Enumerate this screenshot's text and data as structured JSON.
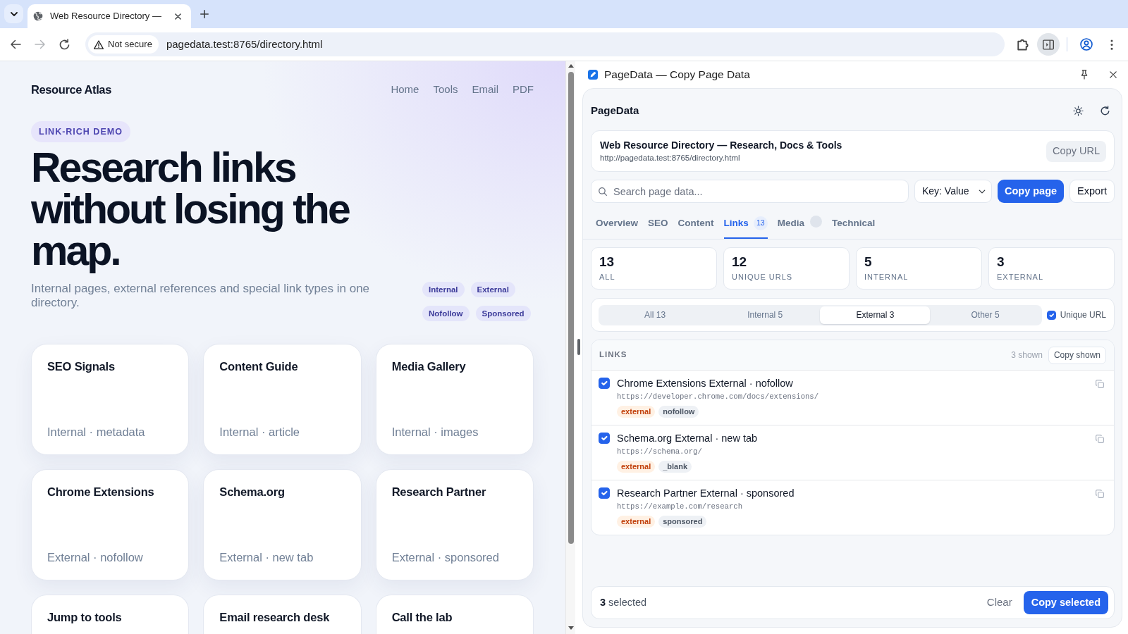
{
  "browser": {
    "tab": {
      "title": "Web Resource Directory —"
    },
    "security_label": "Not secure",
    "url": "pagedata.test:8765/directory.html",
    "forward_disabled": true,
    "side_panel_active": true
  },
  "site": {
    "brand": "Resource Atlas",
    "nav": [
      "Home",
      "Tools",
      "Email",
      "PDF"
    ],
    "eyebrow": "LINK-RICH DEMO",
    "headline": "Research links without losing the map.",
    "lede": "Internal pages, external references and special link types in one directory.",
    "tags": [
      "Internal",
      "External",
      "Nofollow",
      "Sponsored"
    ],
    "cards": [
      {
        "title": "SEO Signals",
        "meta": "Internal · metadata"
      },
      {
        "title": "Content Guide",
        "meta": "Internal · article"
      },
      {
        "title": "Media Gallery",
        "meta": "Internal · images"
      },
      {
        "title": "Chrome Extensions",
        "meta": "External · nofollow"
      },
      {
        "title": "Schema.org",
        "meta": "External · new tab"
      },
      {
        "title": "Research Partner",
        "meta": "External · sponsored"
      },
      {
        "title": "Jump to tools"
      },
      {
        "title": "Email research desk"
      },
      {
        "title": "Call the lab"
      }
    ]
  },
  "side_panel": {
    "title": "PageData — Copy Page Data",
    "app_name": "PageData",
    "page": {
      "title": "Web Resource Directory — Research, Docs & Tools",
      "url": "http://pagedata.test:8765/directory.html",
      "copy_button": "Copy URL"
    },
    "search": {
      "placeholder": "Search page data..."
    },
    "format": {
      "value": "Key: Value"
    },
    "copy_page_button": "Copy page",
    "export_button": "Export",
    "tabs": [
      {
        "label": "Overview",
        "selected": false
      },
      {
        "label": "SEO",
        "selected": false
      },
      {
        "label": "Content",
        "selected": false
      },
      {
        "label": "Links",
        "count": "13",
        "selected": true
      },
      {
        "label": "Media",
        "count_pending": true,
        "selected": false
      },
      {
        "label": "Technical",
        "selected": false
      }
    ],
    "stats": [
      {
        "value": "13",
        "label": "ALL"
      },
      {
        "value": "12",
        "label": "UNIQUE URLS"
      },
      {
        "value": "5",
        "label": "INTERNAL"
      },
      {
        "value": "3",
        "label": "EXTERNAL"
      }
    ],
    "filters": [
      {
        "label": "All 13",
        "selected": false
      },
      {
        "label": "Internal 5",
        "selected": false
      },
      {
        "label": "External 3",
        "selected": true
      },
      {
        "label": "Other 5",
        "selected": false
      }
    ],
    "unique_url": {
      "label": "Unique URL",
      "checked": true
    },
    "links": {
      "heading": "LINKS",
      "shown": "3 shown",
      "copy_button": "Copy shown",
      "items": [
        {
          "title": "Chrome Extensions External · nofollow",
          "url": "https://developer.chrome.com/docs/extensions/",
          "checked": true,
          "tags": [
            {
              "label": "external",
              "kind": "external"
            },
            {
              "label": "nofollow",
              "kind": "attribute"
            }
          ]
        },
        {
          "title": "Schema.org External · new tab",
          "url": "https://schema.org/",
          "checked": true,
          "tags": [
            {
              "label": "external",
              "kind": "external"
            },
            {
              "label": "_blank",
              "kind": "attribute"
            }
          ]
        },
        {
          "title": "Research Partner External · sponsored",
          "url": "https://example.com/research",
          "checked": true,
          "tags": [
            {
              "label": "external",
              "kind": "external"
            },
            {
              "label": "sponsored",
              "kind": "attribute"
            }
          ]
        }
      ]
    },
    "selection": {
      "text": "**3** selected",
      "clear_button": "Clear",
      "copy_button": "Copy selected"
    }
  }
}
